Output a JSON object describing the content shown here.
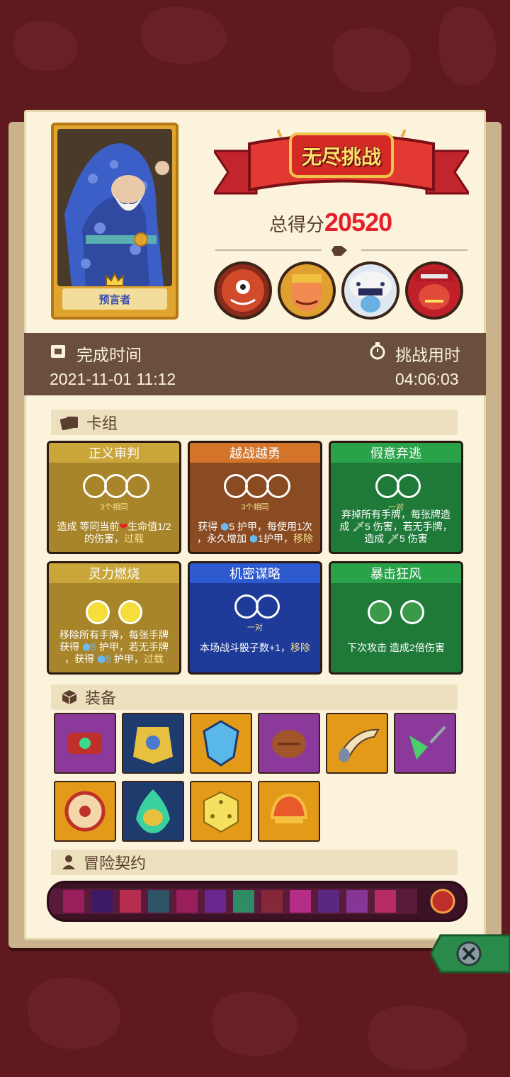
{
  "hero": {
    "name": "预言者"
  },
  "header": {
    "title": "无尽挑战",
    "score_label": "总得分",
    "score_value": "20520"
  },
  "bosses": [
    "boss-1",
    "boss-2",
    "boss-3",
    "boss-4"
  ],
  "times": {
    "complete_label": "完成时间",
    "complete_value": "2021-11-01 11:12",
    "duration_label": "挑战用时",
    "duration_value": "04:06:03"
  },
  "deck": {
    "section_label": "卡组",
    "cards": [
      {
        "title": "正义审判",
        "sub": "3个相同",
        "desc_a": "造成 等同当前",
        "desc_b": "生命值1/2",
        "desc_c": "的伤害，",
        "desc_d": "过载",
        "color": "#a8852a"
      },
      {
        "title": "越战越勇",
        "sub": "3个相同",
        "desc_a": "获得",
        "desc_b": "5 护甲，每使用1次",
        "desc_c": "，永久增加",
        "desc_d": "1护甲，",
        "desc_e": "移除",
        "color": "#8a4a22"
      },
      {
        "title": "假意弃逃",
        "sub": "一对",
        "desc_a": "弃掉所有手牌，每张牌造",
        "desc_b": "成",
        "desc_c": "5 伤害，若无手牌，",
        "desc_d": "造成",
        "desc_e": "5 伤害",
        "color": "#1f7a3a"
      },
      {
        "title": "灵力燃烧",
        "desc_a": "移除所有手牌，每张手牌",
        "desc_b": "获得",
        "desc_c": "5",
        "desc_d": "护甲，若无手牌",
        "desc_e": "，获得",
        "desc_f": "5",
        "desc_g": "护甲，",
        "desc_h": "过载",
        "color": "#a8852a"
      },
      {
        "title": "机密谋略",
        "sub": "一对",
        "desc_a": "本场战斗骰子数+1，",
        "desc_b": "移除",
        "color": "#1e3b9a"
      },
      {
        "title": "暴击狂风",
        "desc_a": "下次攻击 造成2倍伤害",
        "color": "#1f7a3a"
      }
    ]
  },
  "equipment": {
    "section_label": "装备",
    "items": [
      {
        "name": "red-bracelet-icon",
        "bg": "#8b3a9c"
      },
      {
        "name": "armor-chest-icon",
        "bg": "#1e3b6e"
      },
      {
        "name": "blue-shield-gem-icon",
        "bg": "#e39a18"
      },
      {
        "name": "leather-glove-icon",
        "bg": "#8b3a9c"
      },
      {
        "name": "horn-icon",
        "bg": "#e39a18"
      },
      {
        "name": "green-kunai-icon",
        "bg": "#8b3a9c"
      },
      {
        "name": "round-shield-icon",
        "bg": "#e39a18"
      },
      {
        "name": "flame-mask-icon",
        "bg": "#1e3b6e"
      },
      {
        "name": "gold-dice-icon",
        "bg": "#e39a18"
      },
      {
        "name": "golden-helmet-icon",
        "bg": "#e39a18"
      }
    ]
  },
  "contract": {
    "section_label": "冒险契约"
  },
  "colors": {
    "accent_red": "#e5212b",
    "panel": "#fbf3dc",
    "bar": "#6a4f3d"
  }
}
